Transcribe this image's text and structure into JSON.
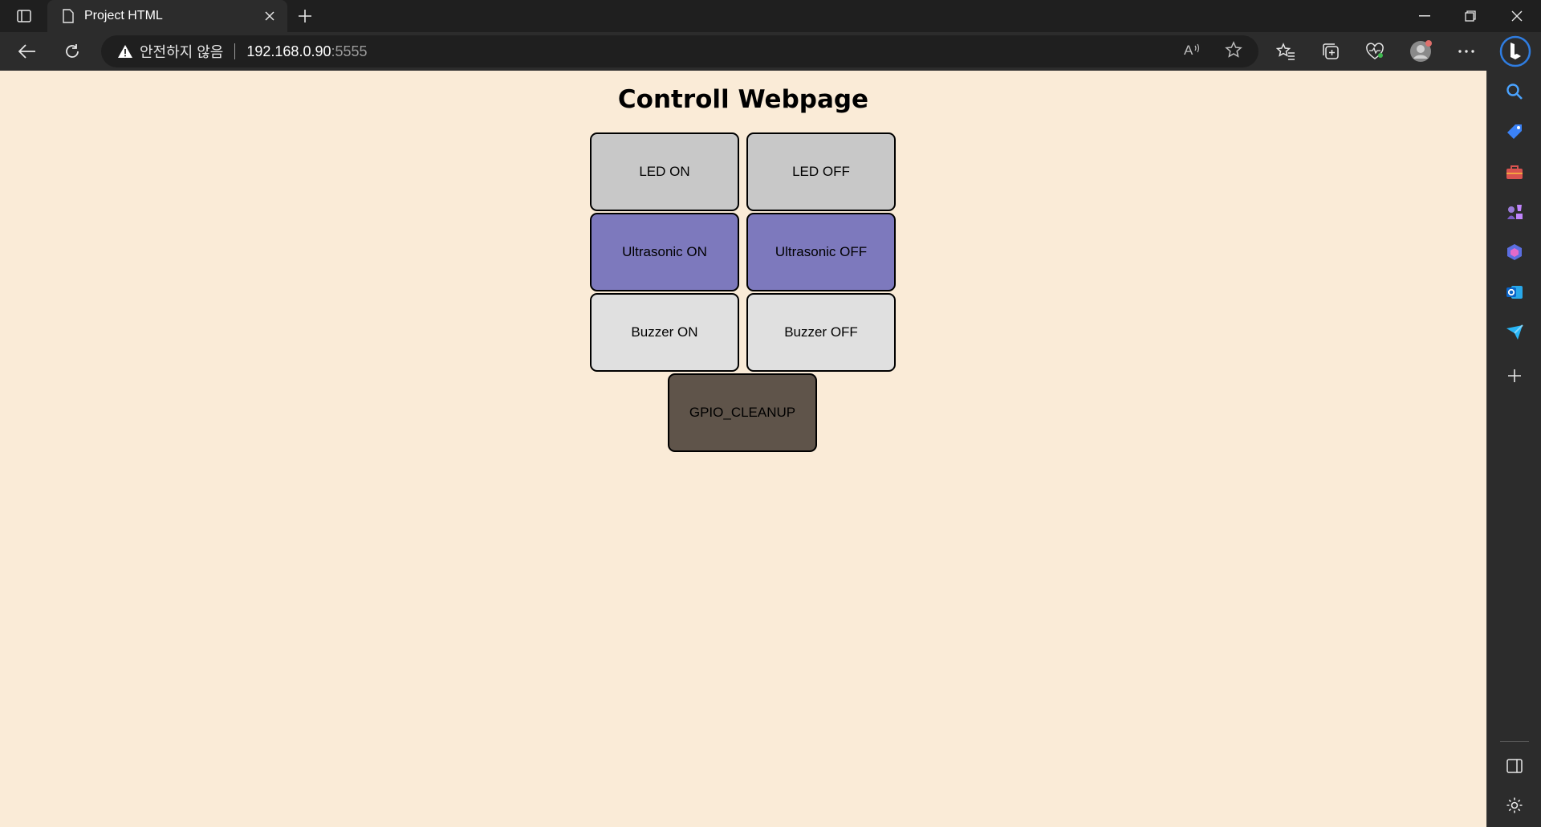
{
  "browser": {
    "tab_title": "Project HTML",
    "security_label": "안전하지 않음",
    "url_host": "192.168.0.90",
    "url_port": ":5555"
  },
  "page": {
    "heading": "Controll Webpage",
    "buttons": {
      "led_on": "LED ON",
      "led_off": "LED OFF",
      "ultrasonic_on": "Ultrasonic ON",
      "ultrasonic_off": "Ultrasonic OFF",
      "buzzer_on": "Buzzer ON",
      "buzzer_off": "Buzzer OFF",
      "gpio_cleanup": "GPIO_CLEANUP"
    }
  },
  "colors": {
    "page_background": "#faebd7",
    "led_buttons": "#c8c8c8",
    "ultrasonic_buttons": "#7d79bd",
    "buzzer_buttons": "#e0e0e0",
    "cleanup_button": "#5f544a"
  }
}
